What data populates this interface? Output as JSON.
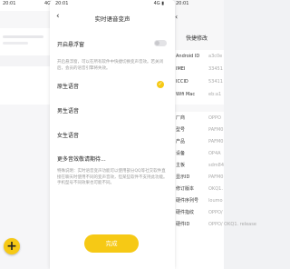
{
  "left": {
    "status_time": "20:01",
    "status_icons": "4G",
    "fab_label": "+"
  },
  "dialog": {
    "status_time": "20:01",
    "status_right": "4G ▮",
    "back_icon": "‹",
    "title": "实时语音变声",
    "floating_toggle_label": "开启悬浮窗",
    "floating_toggle_on": false,
    "description": "开启悬浮窗，可以在所有软件中快捷切换变声音效。若关闭后，会员的语音引擎将失效。",
    "options": [
      {
        "label": "原生语音",
        "selected": true
      },
      {
        "label": "男生语音",
        "selected": false
      },
      {
        "label": "女生语音",
        "selected": false
      },
      {
        "label": "更多音效敬请期待...",
        "selected": false
      }
    ],
    "check_icon": "✓",
    "notice": "特殊说明：实时语音变声功能可以使用部分QQ等社交软件直接在聊天时使用不同的变声音效，但某些软件不支持此功能。手机型号不同效果也可能不同。",
    "done_label": "完成",
    "accent_color": "#f6c915"
  },
  "right": {
    "status_time": "20:01",
    "back_icon": "‹",
    "title": "快捷修改",
    "rows_top": [
      {
        "label": "Android ID",
        "value": "a3c0e"
      },
      {
        "label": "IMEI",
        "value": "33451"
      },
      {
        "label": "ICCID",
        "value": "53411"
      },
      {
        "label": "Wifi Mac",
        "value": "eb:a1"
      }
    ],
    "rows_bottom": [
      {
        "label": "厂商",
        "value": "OPPO"
      },
      {
        "label": "型号",
        "value": "PAFM0"
      },
      {
        "label": "产品",
        "value": "PAFM0"
      },
      {
        "label": "设备",
        "value": "OP4A"
      },
      {
        "label": "主板",
        "value": "sdm84"
      },
      {
        "label": "显示ID",
        "value": "PAFM0"
      },
      {
        "label": "修订版本",
        "value": "OKQ1."
      },
      {
        "label": "硬件序列号",
        "value": "loumo"
      },
      {
        "label": "硬件指纹",
        "value": "OPPO/"
      },
      {
        "label": "硬件ID",
        "value": "OPPO/ OKQ1. release"
      }
    ]
  }
}
